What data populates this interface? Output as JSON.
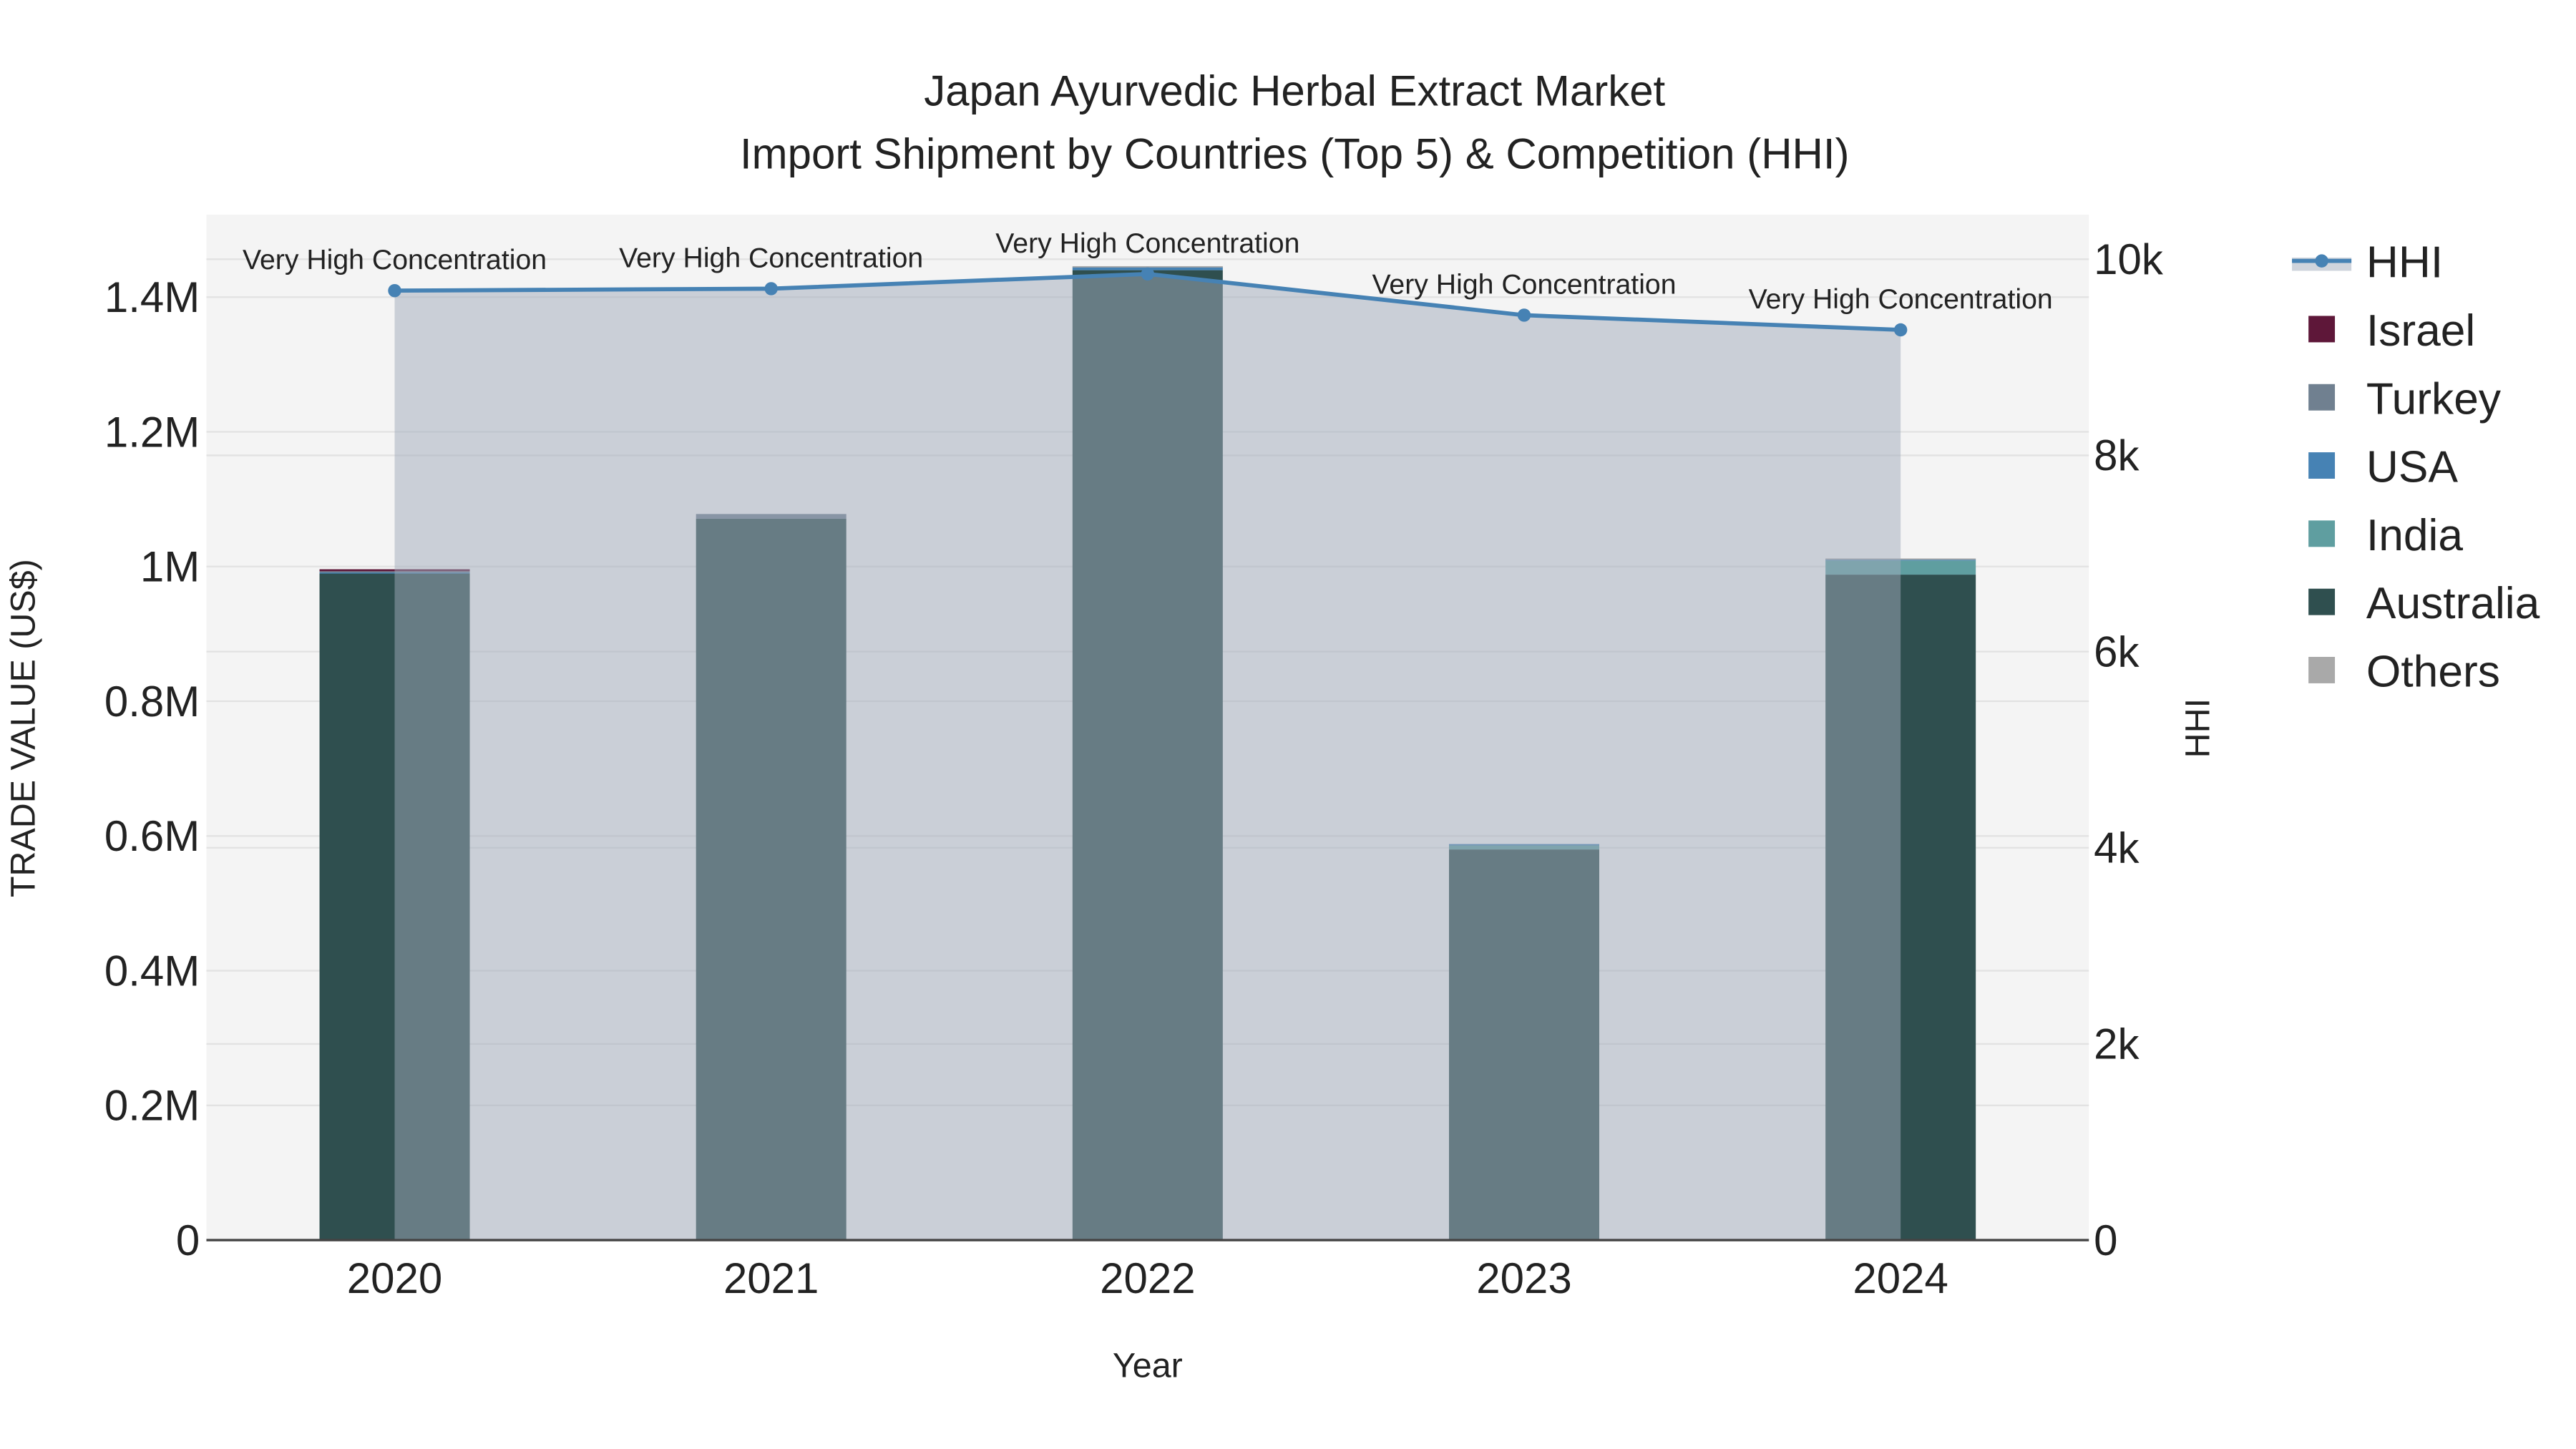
{
  "chart_data": {
    "type": "bar",
    "title": "Japan Ayurvedic Herbal Extract Market",
    "subtitle": "Import Shipment by Countries (Top 5) & Competition (HHI)",
    "xlabel": "Year",
    "ylabel": "TRADE VALUE (US$)",
    "y2label": "HHI",
    "categories": [
      "2020",
      "2021",
      "2022",
      "2023",
      "2024"
    ],
    "ylim": [
      0,
      1520000
    ],
    "y2lim": [
      0,
      10400
    ],
    "yticks": [
      0,
      200000,
      400000,
      600000,
      800000,
      1000000,
      1200000,
      1400000
    ],
    "ytick_labels": [
      "0",
      "0.2M",
      "0.4M",
      "0.6M",
      "0.8M",
      "1M",
      "1.2M",
      "1.4M"
    ],
    "y2ticks": [
      0,
      2000,
      4000,
      6000,
      8000,
      10000
    ],
    "y2tick_labels": [
      "0",
      "2k",
      "4k",
      "6k",
      "8k",
      "10k"
    ],
    "grid": true,
    "legend_position": "right",
    "series": [
      {
        "name": "Australia",
        "color": "#2f4f4f",
        "values": [
          990000,
          1071000,
          1440000,
          580000,
          988000
        ]
      },
      {
        "name": "India",
        "color": "#5f9ea0",
        "values": [
          0,
          0,
          0,
          6000,
          21000
        ]
      },
      {
        "name": "USA",
        "color": "#4682b4",
        "values": [
          1500,
          0,
          5000,
          2000,
          2000
        ]
      },
      {
        "name": "Turkey",
        "color": "#708090",
        "values": [
          1500,
          7000,
          0,
          0,
          0
        ]
      },
      {
        "name": "Israel",
        "color": "#5e1739",
        "values": [
          3000,
          0,
          0,
          0,
          0
        ]
      },
      {
        "name": "Others",
        "color": "#a9a9a9",
        "values": [
          0,
          0,
          1000,
          0,
          1000
        ]
      }
    ],
    "hhi": {
      "name": "HHI",
      "color": "#4682b4",
      "values": [
        9680,
        9700,
        9850,
        9430,
        9280
      ],
      "annotations": [
        "Very High Concentration",
        "Very High Concentration",
        "Very High Concentration",
        "Very High Concentration",
        "Very High Concentration"
      ]
    },
    "legend": [
      "HHI",
      "Israel",
      "Turkey",
      "USA",
      "India",
      "Australia",
      "Others"
    ]
  }
}
